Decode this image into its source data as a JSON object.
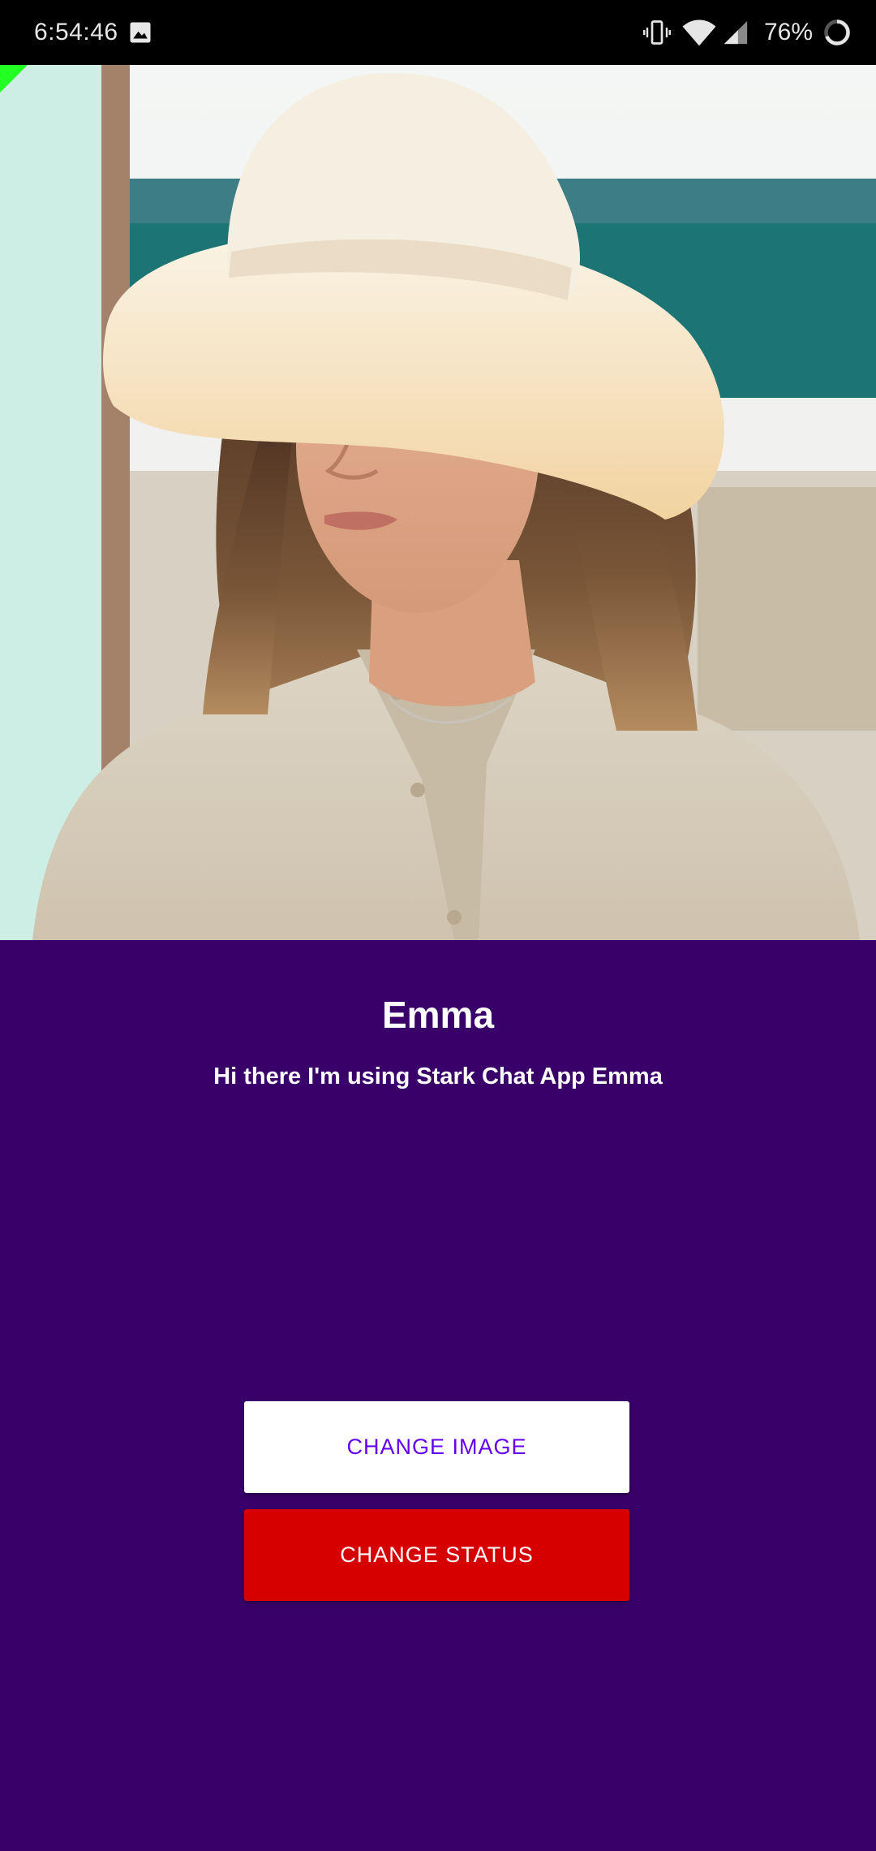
{
  "status_bar": {
    "time": "6:54:46",
    "battery_percent": "76%",
    "icons": [
      "gallery-icon",
      "vibrate-icon",
      "wifi-icon",
      "signal-icon",
      "battery-icon"
    ]
  },
  "profile": {
    "name": "Emma",
    "status": "Hi there I'm using Stark Chat App Emma"
  },
  "buttons": {
    "change_image": "CHANGE IMAGE",
    "change_status": "CHANGE STATUS"
  },
  "colors": {
    "background": "#380068",
    "change_image_bg": "#ffffff",
    "change_image_text": "#6200ee",
    "change_status_bg": "#d60000",
    "change_status_text": "#ffffff",
    "status_bar": "#000000"
  }
}
